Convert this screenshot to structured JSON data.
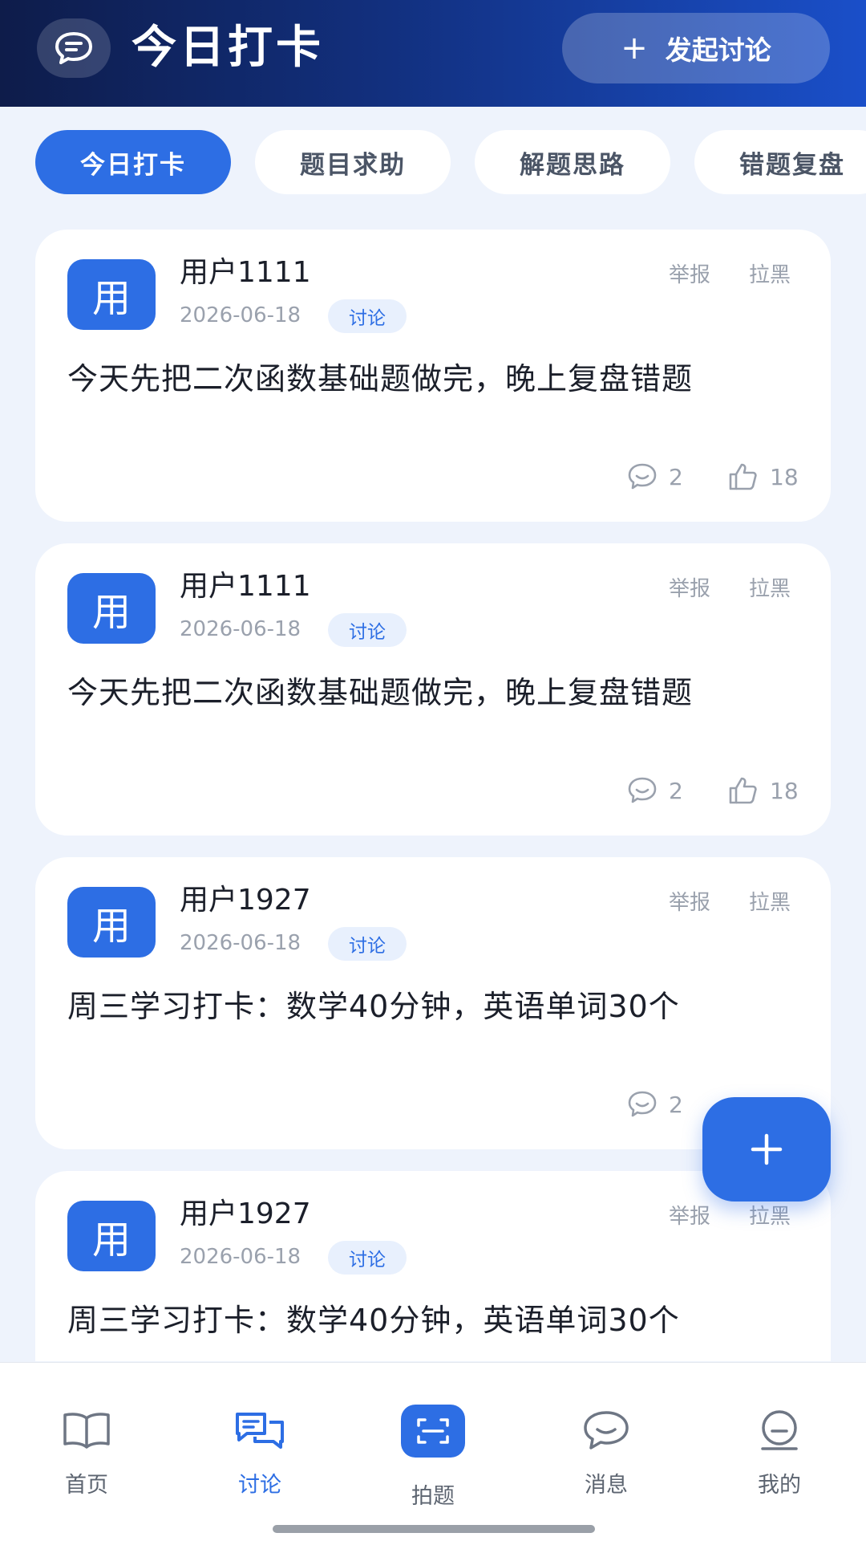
{
  "header": {
    "title": "今日打卡",
    "action_label": "发起讨论",
    "action_icon": "plus-icon",
    "left_icon": "chat-bubble-icon"
  },
  "tabs": [
    {
      "label": "今日打卡",
      "active": true
    },
    {
      "label": "题目求助",
      "active": false
    },
    {
      "label": "解题思路",
      "active": false
    },
    {
      "label": "错题复盘",
      "active": false
    }
  ],
  "actions": {
    "report": "举报",
    "block": "拉黑"
  },
  "posts": [
    {
      "avatar": "用",
      "username": "用户1111",
      "date": "2026-06-18",
      "tag": "讨论",
      "content": "今天先把二次函数基础题做完，晚上复盘错题",
      "comments": "2",
      "likes": "18"
    },
    {
      "avatar": "用",
      "username": "用户1111",
      "date": "2026-06-18",
      "tag": "讨论",
      "content": "今天先把二次函数基础题做完，晚上复盘错题",
      "comments": "2",
      "likes": "18"
    },
    {
      "avatar": "用",
      "username": "用户1927",
      "date": "2026-06-18",
      "tag": "讨论",
      "content": "周三学习打卡：数学40分钟，英语单词30个",
      "comments": "2",
      "likes": ""
    },
    {
      "avatar": "用",
      "username": "用户1927",
      "date": "2026-06-18",
      "tag": "讨论",
      "content": "周三学习打卡：数学40分钟，英语单词30个",
      "comments": "",
      "likes": ""
    }
  ],
  "fab_icon": "plus-icon",
  "bottom_nav": [
    {
      "label": "首页",
      "icon": "book-icon",
      "active": false
    },
    {
      "label": "讨论",
      "icon": "discussion-icon",
      "active": true
    },
    {
      "label": "拍题",
      "icon": "scan-icon",
      "active": false
    },
    {
      "label": "消息",
      "icon": "message-icon",
      "active": false
    },
    {
      "label": "我的",
      "icon": "profile-icon",
      "active": false
    }
  ],
  "colors": {
    "primary": "#2d6ee4",
    "header_dark": "#0e1c4a",
    "background": "#eef3fc",
    "muted_text": "#9aa1ad"
  }
}
